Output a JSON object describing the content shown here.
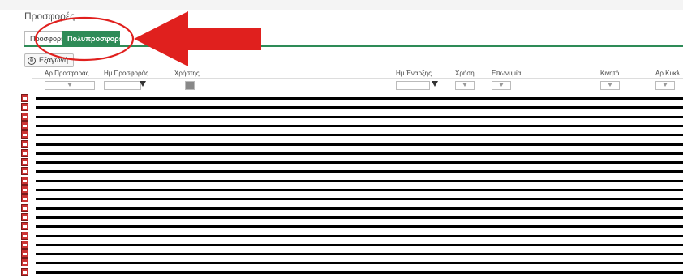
{
  "page": {
    "title": "Προσφορές"
  },
  "tabs": [
    {
      "label": "Προσφορές",
      "active": false
    },
    {
      "label": "Πολυπροσφορές",
      "active": true
    }
  ],
  "toolbar": {
    "export_label": "Εξαγωγή",
    "export_icon": "export-icon"
  },
  "grid": {
    "columns": [
      "Αρ.Προσφοράς",
      "Ημ.Προσφοράς",
      "Χρήστης",
      "Ημ.Έναρξης",
      "Χρήση",
      "Επωνυμία",
      "Κινητό",
      "Αρ.Κυκλ"
    ],
    "row_count": 20,
    "rows_redacted": true
  },
  "annotation": {
    "color": "#e0201e",
    "shape": "arrow-and-circle"
  },
  "colors": {
    "accent": "#2e8b57",
    "redaction": "#000000",
    "pdf_icon": "#c33333"
  }
}
